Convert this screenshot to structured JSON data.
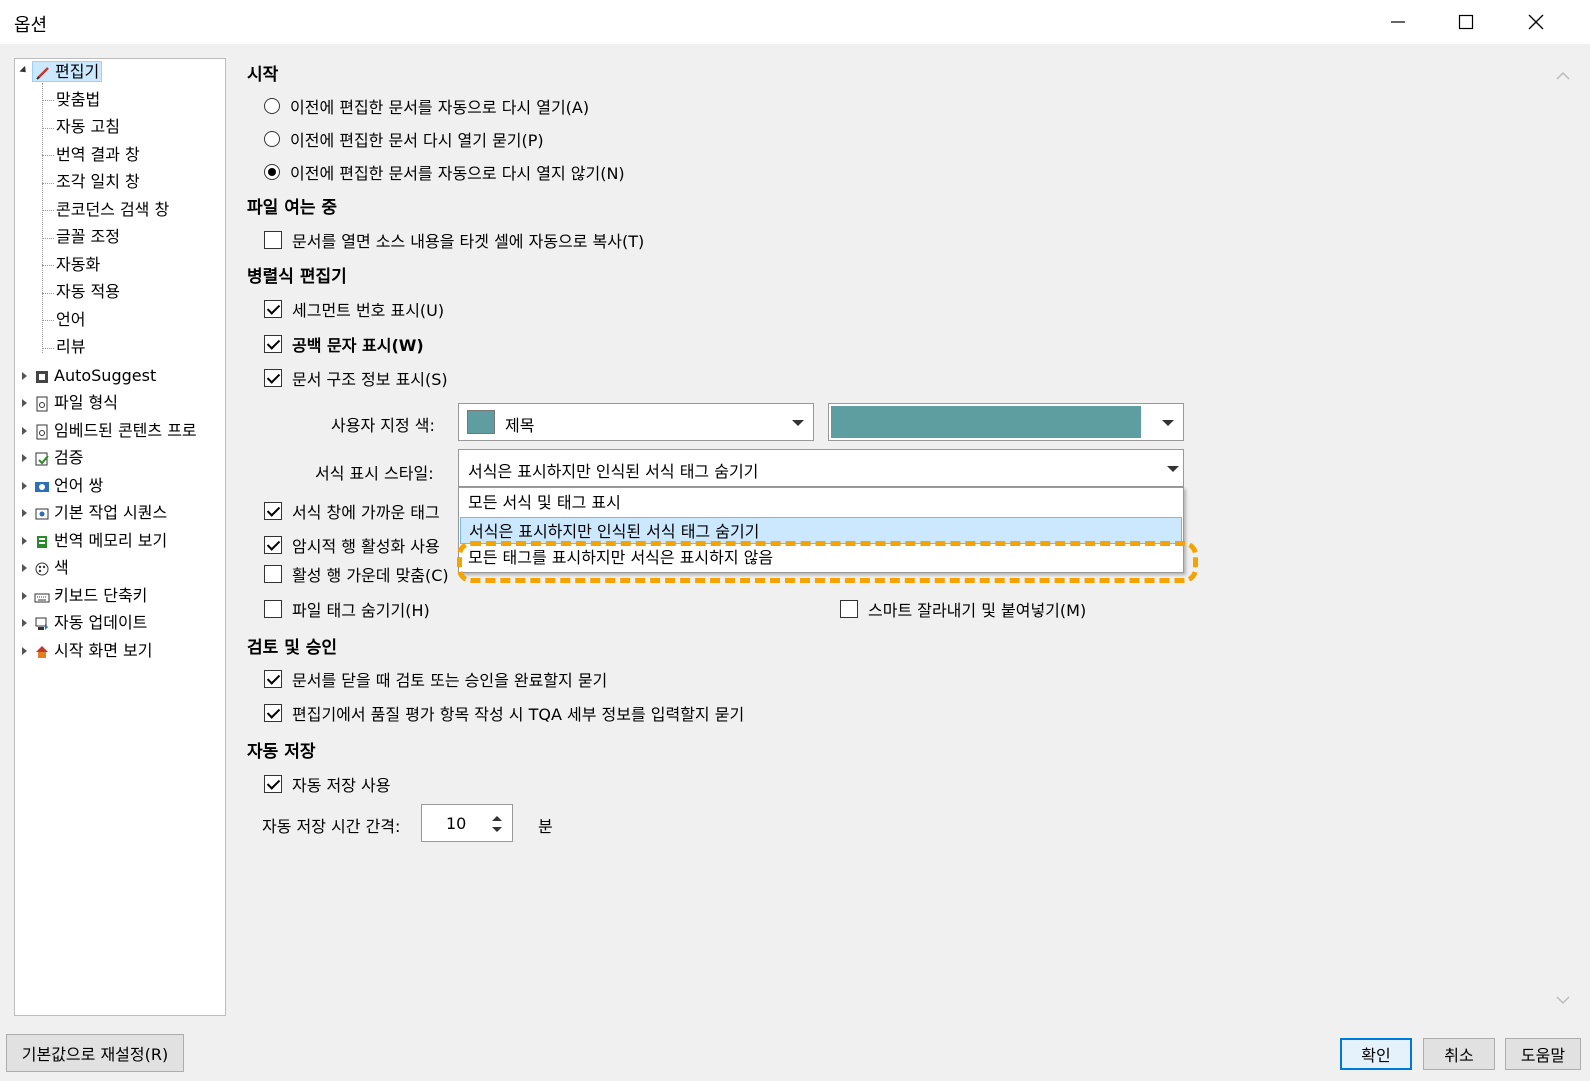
{
  "window": {
    "title": "옵션"
  },
  "tree": {
    "items": [
      {
        "label": "편집기",
        "selected": true,
        "icon": "pencil-icon"
      },
      {
        "label": "맞춤법"
      },
      {
        "label": "자동 고침"
      },
      {
        "label": "번역 결과 창"
      },
      {
        "label": "조각 일치 창"
      },
      {
        "label": "콘코던스 검색 창"
      },
      {
        "label": "글꼴 조정"
      },
      {
        "label": "자동화"
      },
      {
        "label": "자동 적용"
      },
      {
        "label": "언어"
      },
      {
        "label": "리뷰"
      },
      {
        "label": "AutoSuggest",
        "icon": "autosuggest-icon"
      },
      {
        "label": "파일 형식",
        "icon": "file-types-icon"
      },
      {
        "label": "임베드된 콘텐츠 프로",
        "icon": "embedded-content-icon"
      },
      {
        "label": "검증",
        "icon": "verification-icon"
      },
      {
        "label": "언어 쌍",
        "icon": "language-pair-icon"
      },
      {
        "label": "기본 작업 시퀀스",
        "icon": "task-sequence-icon"
      },
      {
        "label": "번역 메모리 보기",
        "icon": "translation-memory-icon"
      },
      {
        "label": "색",
        "icon": "palette-icon"
      },
      {
        "label": "키보드 단축키",
        "icon": "keyboard-icon"
      },
      {
        "label": "자동 업데이트",
        "icon": "update-icon"
      },
      {
        "label": "시작 화면 보기",
        "icon": "home-icon"
      }
    ]
  },
  "start": {
    "header": "시작",
    "radio1": "이전에 편집한 문서를 자동으로 다시 열기(A)",
    "radio2": "이전에 편집한 문서 다시 열기 묻기(P)",
    "radio3": "이전에 편집한 문서를 자동으로 다시 열지 않기(N)"
  },
  "file_open": {
    "header": "파일 여는 중",
    "copy_source": "문서를 열면 소스 내용을 타겟 셀에 자동으로 복사(T)"
  },
  "side_by_side": {
    "header": "병렬식 편집기",
    "segment_numbers": "세그먼트 번호 표시(U)",
    "whitespace": "공백 문자 표시(W)",
    "structure_info": "문서 구조 정보 표시(S)",
    "custom_color_label": "사용자 지정 색:",
    "custom_color_value": "제목",
    "custom_color_swatch": "#5f9ea0",
    "format_style_label": "서식 표시 스타일:",
    "format_style_value": "서식은 표시하지만 인식된 서식 태그 숨기기",
    "dropdown_options": [
      "모든 서식 및 태그 표시",
      "서식은 표시하지만 인식된 서식 태그 숨기기",
      "모든 태그를 표시하지만 서식은 표시하지 않음"
    ],
    "near_tags": "서식 창에 가까운 태그",
    "implicit_row": "암시적 행 활성화 사용",
    "center_row": "활성 행 가운데 맞춤(C)",
    "hide_file_tags": "파일 태그 숨기기(H)",
    "smart_cut_paste": "스마트 잘라내기 및 붙여넣기(M)"
  },
  "review": {
    "header": "검토 및 승인",
    "ask_on_close": "문서를 닫을 때 검토 또는 승인을 완료할지 묻기",
    "ask_tqa": "편집기에서 품질 평가 항목 작성 시 TQA 세부 정보를 입력할지 묻기"
  },
  "autosave": {
    "header": "자동 저장",
    "use": "자동 저장 사용",
    "interval_label": "자동 저장 시간 간격:",
    "interval_value": "10",
    "unit": "분"
  },
  "buttons": {
    "reset": "기본값으로 재설정(R)",
    "ok": "확인",
    "cancel": "취소",
    "help": "도움말"
  },
  "colors": {
    "highlight": "#f5a300",
    "selected": "#cce8ff",
    "accent": "#0078d7"
  }
}
